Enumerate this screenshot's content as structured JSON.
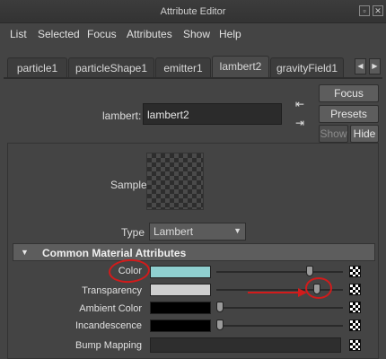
{
  "window": {
    "title": "Attribute Editor",
    "buttons": [
      "▫",
      "✕"
    ]
  },
  "menu": [
    "List",
    "Selected",
    "Focus",
    "Attributes",
    "Show",
    "Help"
  ],
  "tabs": [
    {
      "label": "particle1",
      "active": false
    },
    {
      "label": "particleShape1",
      "active": false
    },
    {
      "label": "emitter1",
      "active": false
    },
    {
      "label": "lambert2",
      "active": true
    },
    {
      "label": "gravityField1",
      "active": false
    }
  ],
  "tab_scroll": {
    "left": "◀",
    "right": "▶"
  },
  "node": {
    "label": "lambert:",
    "value": "lambert2"
  },
  "buttons": {
    "focus": "Focus",
    "presets": "Presets",
    "show": "Show",
    "hide": "Hide"
  },
  "icons": {
    "input_output_top": "⇤",
    "input_output_bottom": "⇥"
  },
  "sample": {
    "label": "Sample"
  },
  "type": {
    "label": "Type",
    "value": "Lambert",
    "arrow": "▼"
  },
  "section": {
    "title": "Common Material Attributes",
    "expanded": true,
    "triangle": "▼"
  },
  "attributes": [
    {
      "label": "Color",
      "color": "#8fcfcf",
      "slider": 0.75,
      "has_slider": true
    },
    {
      "label": "Transparency",
      "color": "#cfcfcf",
      "slider": 0.81,
      "has_slider": true
    },
    {
      "label": "Ambient Color",
      "color": "#000000",
      "slider": 0.0,
      "has_slider": true
    },
    {
      "label": "Incandescence",
      "color": "#000000",
      "slider": 0.0,
      "has_slider": true
    },
    {
      "label": "Bump Mapping",
      "color": null,
      "slider": null,
      "has_slider": false
    }
  ],
  "annotation": {
    "color": "#d21b1b"
  }
}
